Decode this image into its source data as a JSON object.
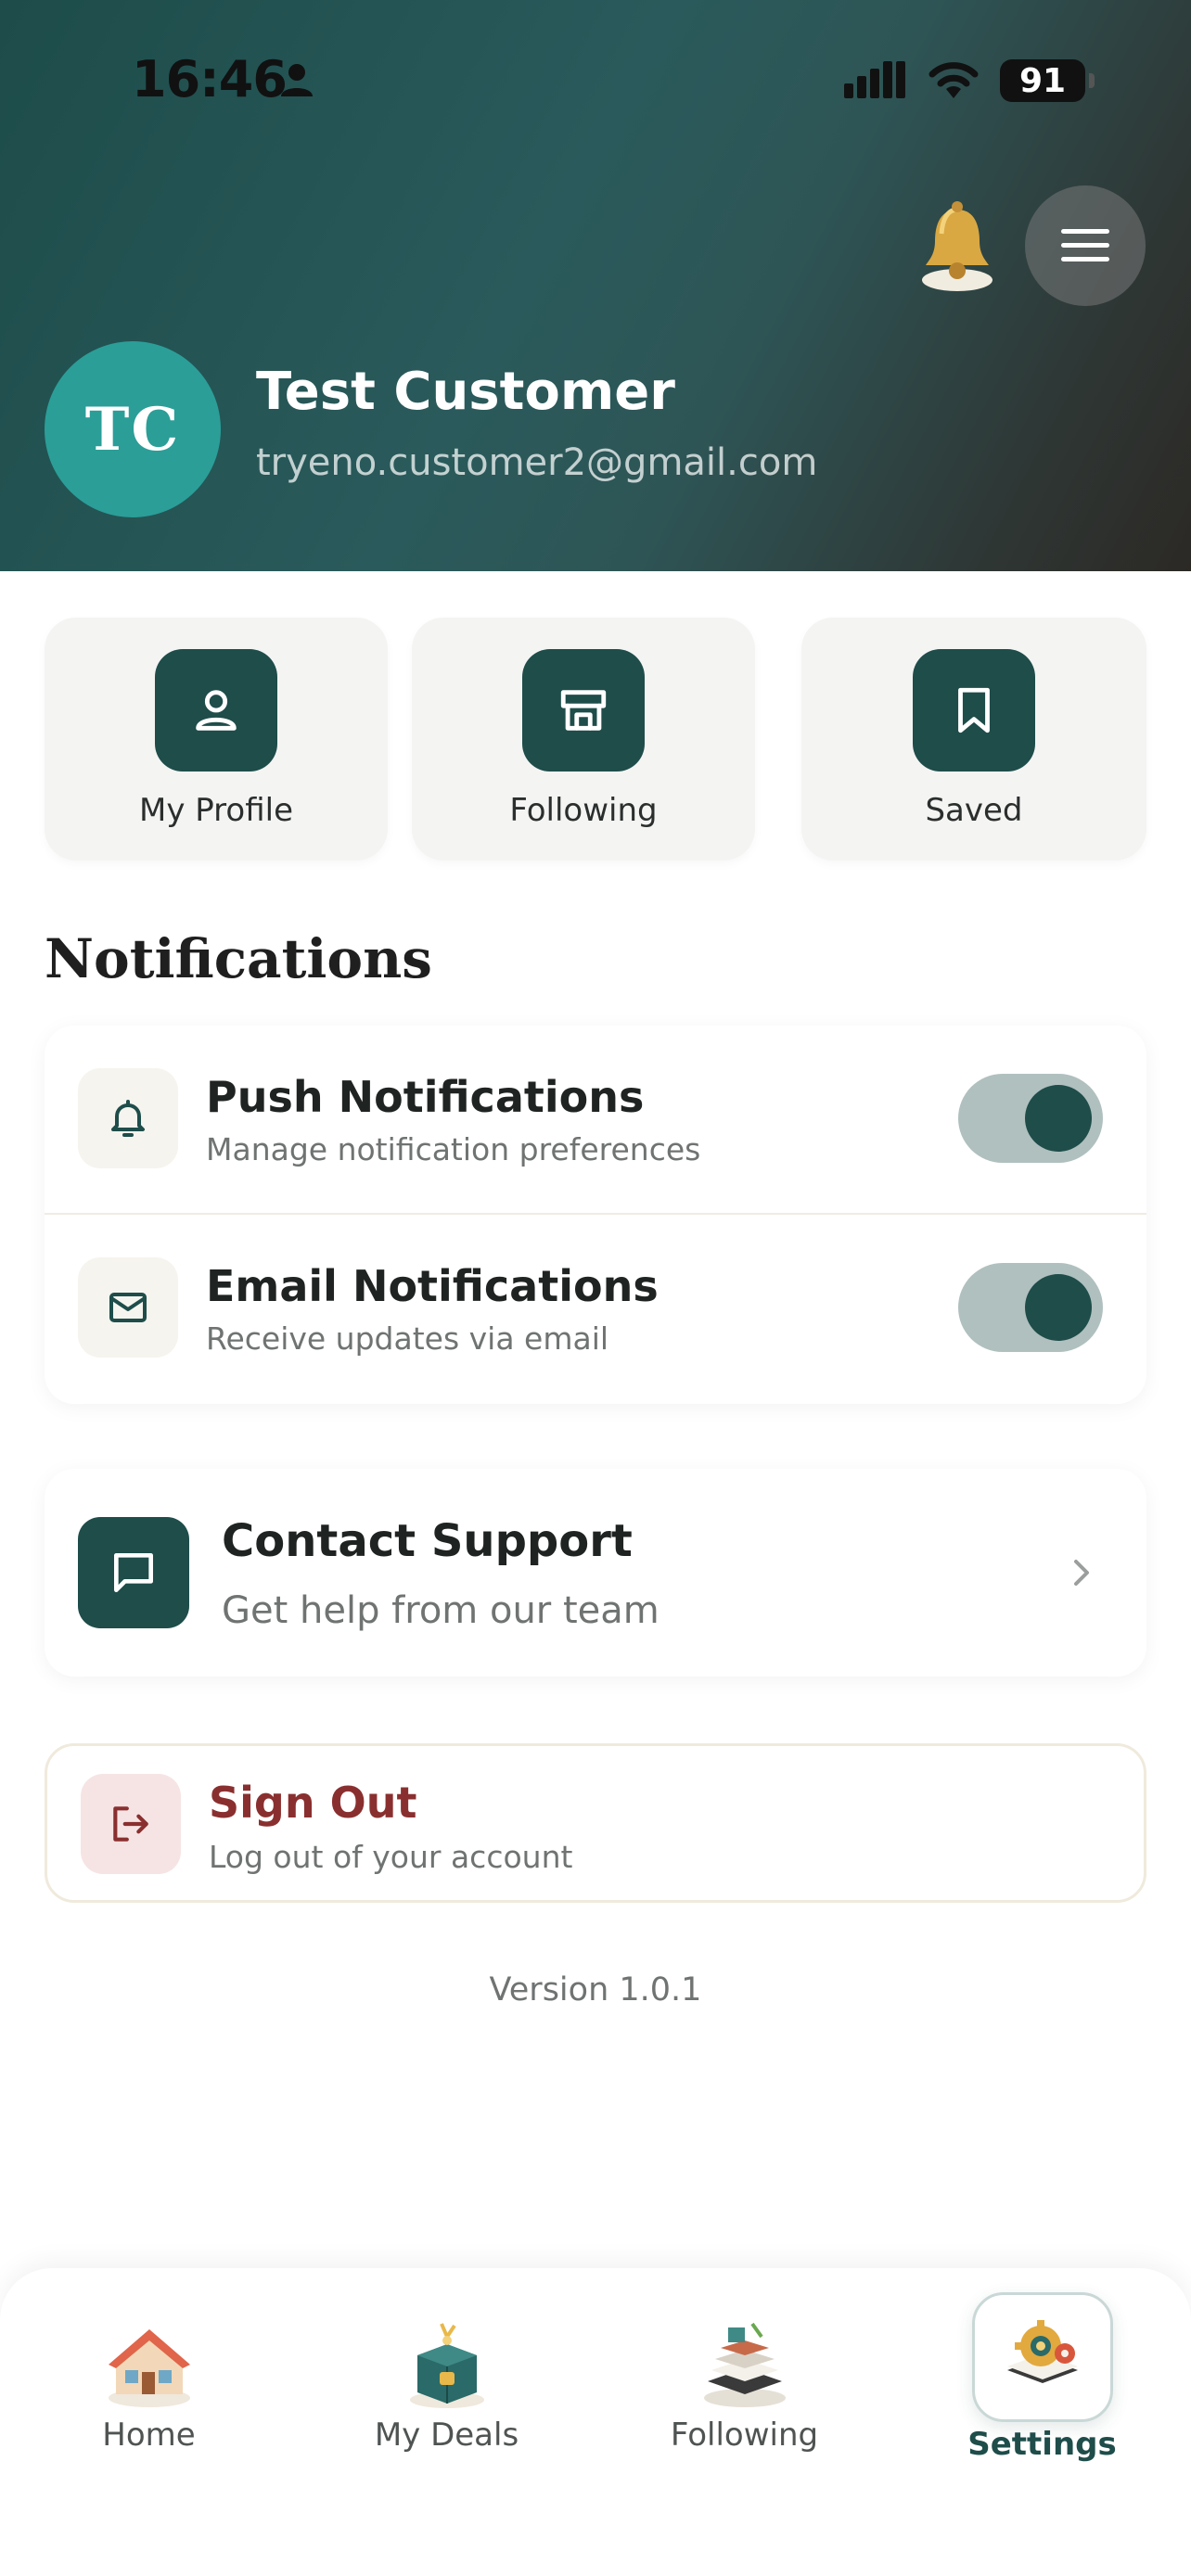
{
  "status_bar": {
    "time": "16:46",
    "battery": "91",
    "icons": [
      "person-icon",
      "cellular-signal-icon",
      "wifi-icon",
      "battery-icon"
    ]
  },
  "header": {
    "bell_icon": "bell-3d-icon",
    "menu_icon": "hamburger-menu-icon",
    "avatar_initials": "TC",
    "user_name": "Test Customer",
    "user_email": "tryeno.customer2@gmail.com"
  },
  "quick_actions": [
    {
      "label": "My Profile",
      "icon": "user-icon"
    },
    {
      "label": "Following",
      "icon": "store-icon"
    },
    {
      "label": "Saved",
      "icon": "bookmark-icon"
    }
  ],
  "notifications": {
    "title": "Notifications",
    "items": [
      {
        "title": "Push Notifications",
        "subtitle": "Manage notification preferences",
        "icon": "bell-icon",
        "enabled": true
      },
      {
        "title": "Email Notifications",
        "subtitle": "Receive updates via email",
        "icon": "mail-icon",
        "enabled": true
      }
    ]
  },
  "support": {
    "title": "Contact Support",
    "subtitle": "Get help from our team",
    "icon": "chat-icon"
  },
  "signout": {
    "title": "Sign Out",
    "subtitle": "Log out of your account",
    "icon": "logout-icon"
  },
  "version": "Version 1.0.1",
  "bottom_nav": {
    "active": "Settings",
    "items": [
      {
        "label": "Home",
        "icon": "house-icon"
      },
      {
        "label": "My Deals",
        "icon": "deals-box-icon"
      },
      {
        "label": "Following",
        "icon": "store-stack-icon"
      },
      {
        "label": "Settings",
        "icon": "settings-gear-icon"
      }
    ]
  },
  "colors": {
    "primary": "#1e4d4a",
    "avatar": "#2b9e98",
    "toggle_track": "#b0c0bf",
    "danger": "#8a2f2f",
    "danger_bg": "#f6e4e4"
  }
}
